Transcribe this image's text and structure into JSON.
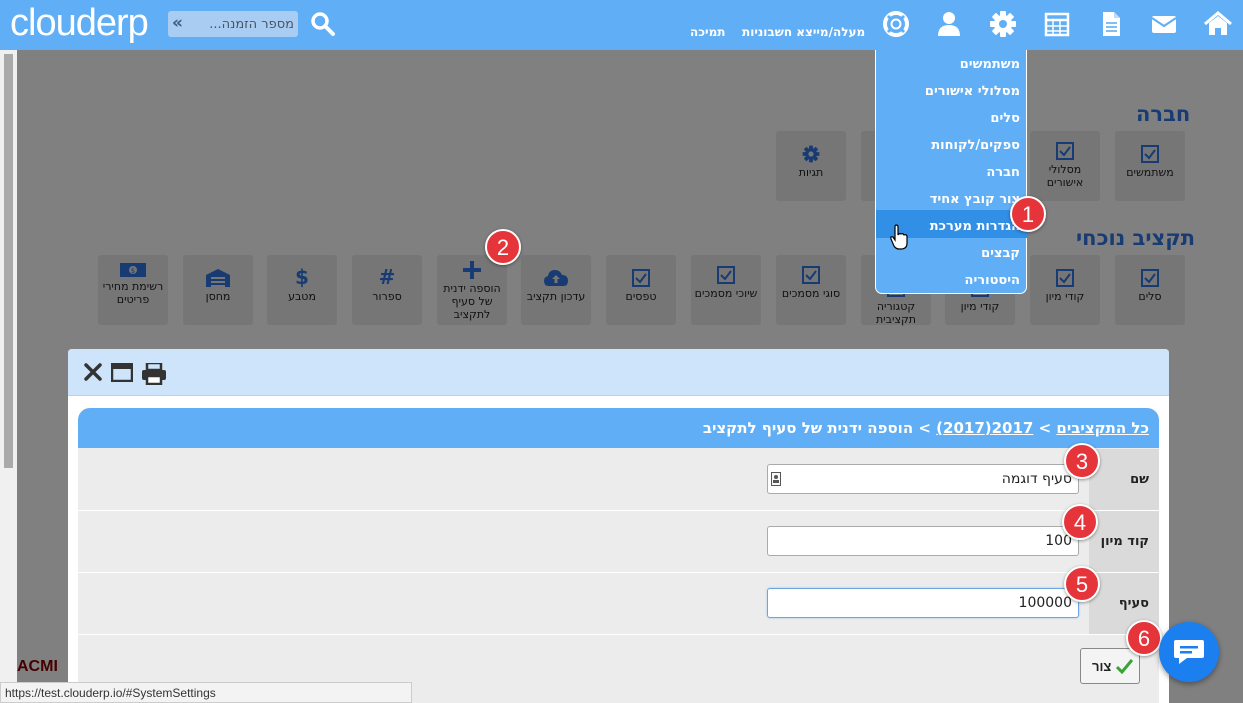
{
  "brand": {
    "logo_text": "clouderp"
  },
  "header": {
    "search_placeholder": "מספר הזמנה...",
    "links": {
      "upload": "מעלה/מייצא חשבוניות",
      "support": "תמיכה"
    }
  },
  "menu": {
    "items": [
      "משתמשים",
      "מסלולי אישורים",
      "סלים",
      "ספקים/לקוחות",
      "חברה",
      "צור קובץ אחיד",
      "הגדרות מערכת",
      "קבצים",
      "היסטוריה"
    ],
    "highlighted_index": 6
  },
  "sections": {
    "company": {
      "title": "חברה",
      "tiles": [
        "משתמשים",
        "מסלולי אישורים",
        "תגיות"
      ]
    },
    "budget": {
      "title": "תקציב נוכחי",
      "tiles": [
        "סלים",
        "קודי מיון",
        "קודי מיון",
        "קטגוריה תקציבית",
        "סוגי מסמכים",
        "שיוכי מסמכים",
        "טפסים",
        "עדכון תקציב",
        "הוספה ידנית של סעיף לתקציב",
        "ספרור",
        "מטבע",
        "מחסן",
        "רשימת מחירי פריטים"
      ]
    }
  },
  "modal": {
    "breadcrumb": {
      "all": "כל התקציבים",
      "sep1": " > ",
      "budget": "2017(2017)",
      "sep2": " > ",
      "current": "הוספה ידנית של סעיף לתקציב"
    },
    "fields": [
      {
        "label": "שם",
        "value": "סעיף דוגמה"
      },
      {
        "label": "קוד מיון",
        "value": "100"
      },
      {
        "label": "סעיף",
        "value": "100000"
      }
    ],
    "save_label": "צור"
  },
  "badges": [
    "1",
    "2",
    "3",
    "4",
    "5",
    "6"
  ],
  "status_bar": {
    "url": "https://test.clouderp.io/#SystemSettings"
  },
  "colors": {
    "primary": "#60aef5",
    "highlight": "#318fe6",
    "badge": "#e5353b",
    "chat": "#1b7ff0",
    "title": "#173b72"
  }
}
